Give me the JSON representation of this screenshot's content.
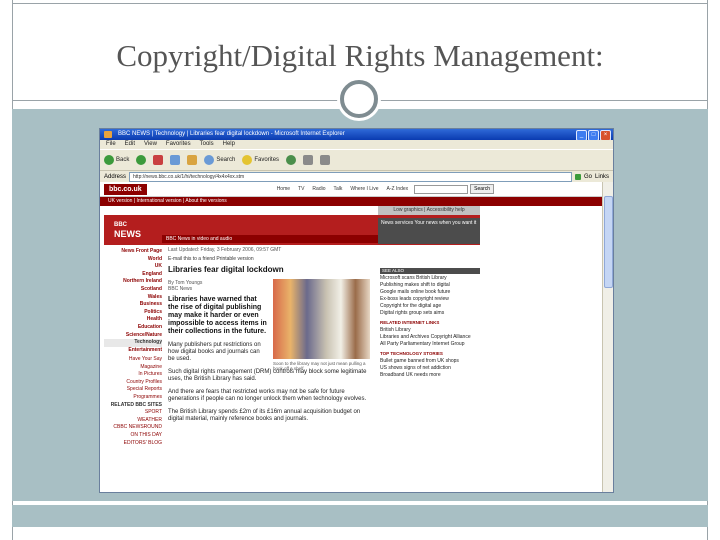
{
  "slide": {
    "title": "Copyright/Digital Rights Management:"
  },
  "browser": {
    "window_title": "BBC NEWS | Technology | Libraries fear digital lockdown - Microsoft Internet Explorer",
    "menu": [
      "File",
      "Edit",
      "View",
      "Favorites",
      "Tools",
      "Help"
    ],
    "toolbar": {
      "back": "Back",
      "search": "Search",
      "favorites": "Favorites"
    },
    "address_label": "Address",
    "url": "http://news.bbc.co.uk/1/hi/technology/4x4x4xx.stm",
    "go": "Go",
    "links": "Links"
  },
  "bbc": {
    "logo": "bbc.co.uk",
    "nav": [
      "Home",
      "TV",
      "Radio",
      "Talk",
      "Where I Live",
      "A-Z Index"
    ],
    "search_button": "Search",
    "sub_bar": "UK version  |  International version  |  About the versions",
    "low_graphics": "Low graphics | Accessibility help",
    "news_logo_top": "BBC",
    "news_logo": "NEWS",
    "banner_strip": "BBC News in video and audio",
    "news_services": "News services\nYour news when you want it",
    "left_nav": [
      "News Front Page",
      "World",
      "UK",
      "England",
      "Northern Ireland",
      "Scotland",
      "Wales",
      "Business",
      "Politics",
      "Health",
      "Education",
      "Science/Nature",
      "Technology",
      "Entertainment"
    ],
    "left_nav_secondary": [
      "Have Your Say",
      "Magazine",
      "In Pictures",
      "Country Profiles",
      "Special Reports",
      "Programmes",
      "RELATED BBC SITES",
      "SPORT",
      "WEATHER",
      "CBBC NEWSROUND",
      "ON THIS DAY",
      "EDITORS' BLOG"
    ],
    "article": {
      "updated": "Last Updated: Friday, 3 February 2006, 09:57 GMT",
      "email_line": "E-mail this to a friend     Printable version",
      "headline": "Libraries fear digital lockdown",
      "byline": "By Tom Youngs\nBBC News",
      "intro": "Libraries have warned that the rise of digital publishing may make it harder or even impossible to access items in their collections in the future.",
      "caption": "Soon to the library may not just mean pulling a book off a shelf",
      "para1": "Many publishers put restrictions on how digital books and journals can be used.",
      "para2": "Such digital rights management (DRM) controls may block some legitimate uses, the British Library has said.",
      "para3": "And there are fears that restricted works may not be safe for future generations if people can no longer unlock them when technology evolves.",
      "para4": "The British Library spends £2m of its £16m annual acquisition budget on digital material, mainly reference books and journals."
    },
    "see_also_head": "SEE ALSO",
    "see_also": [
      "Microsoft scans British Library",
      "Publishing makes shift to digital",
      "Google mails online book future",
      "Ex-boss leads copyright review",
      "Copyright for the digital age",
      "Digital rights group sets aims"
    ],
    "related_head": "RELATED INTERNET LINKS",
    "related": [
      "British Library",
      "Libraries and Archives Copyright Alliance",
      "All Party Parliamentary Internet Group"
    ],
    "top_stories_head": "TOP TECHNOLOGY STORIES",
    "top_stories": [
      "Bullet game banned from UK shops",
      "US shows signs of net addiction",
      "Broadband UK needs more"
    ]
  }
}
